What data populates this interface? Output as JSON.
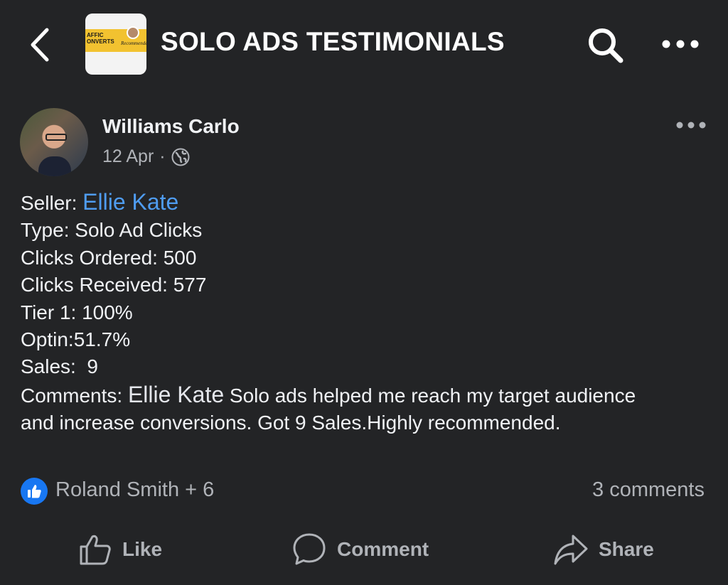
{
  "header": {
    "title": "SOLO ADS TESTIMONIALS",
    "thumb_text": "AFFIC\nONVERTS",
    "thumb_script": "Recommended"
  },
  "post": {
    "author": "Williams Carlo",
    "date": "12 Apr",
    "separator": "·",
    "seller_label": "Seller:",
    "seller_name": "Ellie Kate",
    "type": "Type: Solo Ad Clicks",
    "clicks_ordered": "Clicks Ordered: 500",
    "clicks_received": "Clicks Received: 577",
    "tier1": "Tier 1: 100%",
    "optin": "Optin:51.7%",
    "sales": "Sales:  9",
    "comments_label": "Comments:",
    "comments_mention": "Ellie Kate",
    "comments_text": "Solo ads helped me reach my target audience and increase conversions. Got 9 Sales.Highly recommended."
  },
  "reactions": {
    "reactors": "Roland Smith + 6",
    "comments_count": "3 comments"
  },
  "actions": {
    "like": "Like",
    "comment": "Comment",
    "share": "Share"
  },
  "colors": {
    "background": "#232426",
    "link_blue": "#4f9cf0",
    "like_blue": "#1877f2",
    "muted": "#b0b3b8"
  },
  "icons": [
    "back-icon",
    "search-icon",
    "more-icon",
    "globe-icon",
    "like-reaction-icon",
    "thumbs-up-icon",
    "comment-icon",
    "share-icon"
  ]
}
